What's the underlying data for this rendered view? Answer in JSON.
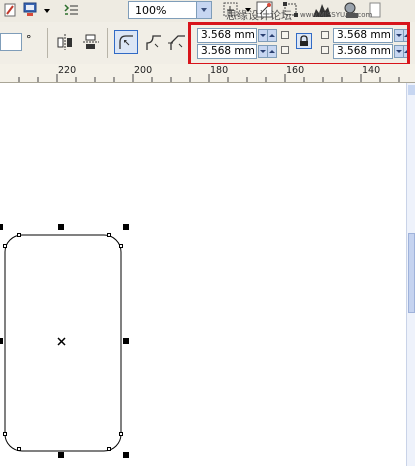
{
  "toolbar": {
    "zoom_value": "100%"
  },
  "property_bar": {
    "degree_symbol": "°",
    "corner_top_left": "3.568 mm",
    "corner_bottom_left": "3.568 mm",
    "corner_top_right": "3.568 mm",
    "corner_bottom_right": "3.568 mm",
    "highlight_color": "#d8141b"
  },
  "watermark": {
    "text": "思缘设计论坛",
    "url": "www.MISSYUAN.com"
  },
  "ruler": {
    "labels": [
      "220",
      "200",
      "180",
      "160",
      "140"
    ]
  },
  "icons": {
    "lock": "padlock-icon",
    "corner_round": "round-corner-icon",
    "corner_scallop": "scallop-corner-icon",
    "corner_chamfer": "chamfer-corner-icon"
  }
}
